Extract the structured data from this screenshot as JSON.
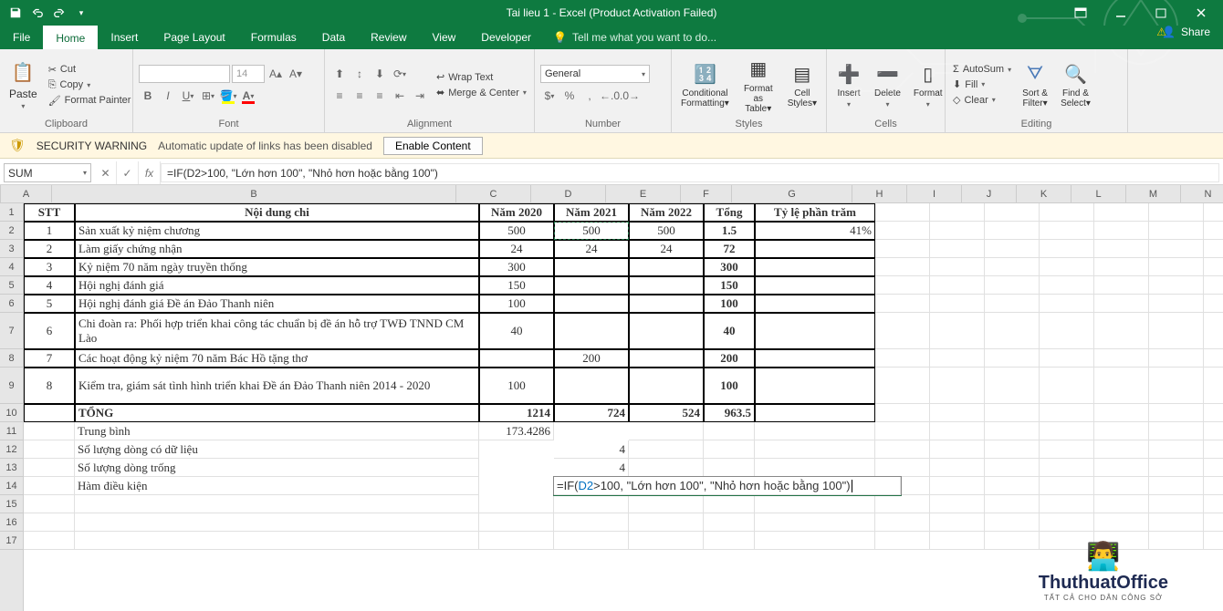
{
  "title": "Tai lieu 1 - Excel (Product Activation Failed)",
  "menu": {
    "file": "File",
    "home": "Home",
    "insert": "Insert",
    "page_layout": "Page Layout",
    "formulas": "Formulas",
    "data": "Data",
    "review": "Review",
    "view": "View",
    "developer": "Developer",
    "tell_me": "Tell me what you want to do...",
    "share": "Share"
  },
  "ribbon": {
    "clipboard": {
      "paste": "Paste",
      "cut": "Cut",
      "copy": "Copy",
      "format_painter": "Format Painter",
      "label": "Clipboard"
    },
    "font": {
      "size": "14",
      "label": "Font"
    },
    "alignment": {
      "wrap": "Wrap Text",
      "merge": "Merge & Center",
      "label": "Alignment"
    },
    "number": {
      "format": "General",
      "label": "Number"
    },
    "styles": {
      "cond": "Conditional Formatting",
      "fat": "Format as Table",
      "cell": "Cell Styles",
      "label": "Styles"
    },
    "cells": {
      "insert": "Insert",
      "delete": "Delete",
      "format": "Format",
      "label": "Cells"
    },
    "editing": {
      "autosum": "AutoSum",
      "fill": "Fill",
      "clear": "Clear",
      "sort": "Sort & Filter",
      "find": "Find & Select",
      "label": "Editing"
    }
  },
  "security": {
    "title": "SECURITY WARNING",
    "msg": "Automatic update of links has been disabled",
    "btn": "Enable Content"
  },
  "name_box": "SUM",
  "formula": "=IF(D2>100, \"Lớn hơn 100\", \"Nhỏ hơn hoặc bằng 100\")",
  "columns": [
    "A",
    "B",
    "C",
    "D",
    "E",
    "F",
    "G",
    "H",
    "I",
    "J",
    "K",
    "L",
    "M",
    "N"
  ],
  "col_widths": {
    "A": 56,
    "B": 443,
    "C": 82,
    "D": 82,
    "E": 82,
    "F": 56,
    "G": 132,
    "def": 60
  },
  "headers": {
    "stt": "STT",
    "nd": "Nội dung chi",
    "n2020": "Năm 2020",
    "n2021": "Năm 2021",
    "n2022": "Năm 2022",
    "tong": "Tổng",
    "tylepc": "Tỷ lệ phần trăm"
  },
  "rows": [
    {
      "stt": "1",
      "nd": "Sản xuất kỷ niệm chương",
      "c": "500",
      "d": "500",
      "e": "500",
      "f": "1.5",
      "g": "41%"
    },
    {
      "stt": "2",
      "nd": "Làm giấy chứng nhận",
      "c": "24",
      "d": "24",
      "e": "24",
      "f": "72",
      "g": ""
    },
    {
      "stt": "3",
      "nd": "Kỷ niệm 70 năm ngày truyền thống",
      "c": "300",
      "d": "",
      "e": "",
      "f": "300",
      "g": ""
    },
    {
      "stt": "4",
      "nd": "Hội nghị đánh giá",
      "c": "150",
      "d": "",
      "e": "",
      "f": "150",
      "g": ""
    },
    {
      "stt": "5",
      "nd": "Hội nghị đánh giá Đề án Đảo Thanh niên",
      "c": "100",
      "d": "",
      "e": "",
      "f": "100",
      "g": ""
    },
    {
      "stt": "6",
      "nd": "Chi đoàn ra: Phối hợp triển khai công tác chuẩn bị đề án hỗ trợ TWĐ TNND CM Lào",
      "c": "40",
      "d": "",
      "e": "",
      "f": "40",
      "g": "",
      "tall": true
    },
    {
      "stt": "7",
      "nd": "Các hoạt động kỷ niệm 70 năm Bác Hồ tặng thơ",
      "c": "",
      "d": "200",
      "e": "",
      "f": "200",
      "g": ""
    },
    {
      "stt": "8",
      "nd": "Kiểm tra, giám sát tình hình triển khai Đề án Đảo Thanh niên 2014 - 2020",
      "c": "100",
      "d": "",
      "e": "",
      "f": "100",
      "g": "",
      "tall": true
    }
  ],
  "total_row": {
    "label": "TỔNG",
    "c": "1214",
    "d": "724",
    "e": "524",
    "f": "963.5"
  },
  "extras": [
    {
      "label": "Trung bình",
      "c": "173.4286"
    },
    {
      "label": "Số lượng dòng có dữ liệu",
      "d": "4"
    },
    {
      "label": "Số lượng dòng trống",
      "d": "4"
    },
    {
      "label": "Hàm điều kiện",
      "d_formula": "=IF(D2>100, \"Lớn hơn 100\", \"Nhỏ hơn hoặc bằng 100\")"
    }
  ],
  "inline_formula": {
    "prefix": "=IF(",
    "ref": "D2",
    "rest": ">100, \"Lớn hơn 100\", \"Nhỏ hơn hoặc bằng 100\")"
  },
  "watermark": {
    "title": "ThuthuatOffice",
    "sub": "TẤT CẢ CHO DÂN CÔNG SỞ"
  }
}
